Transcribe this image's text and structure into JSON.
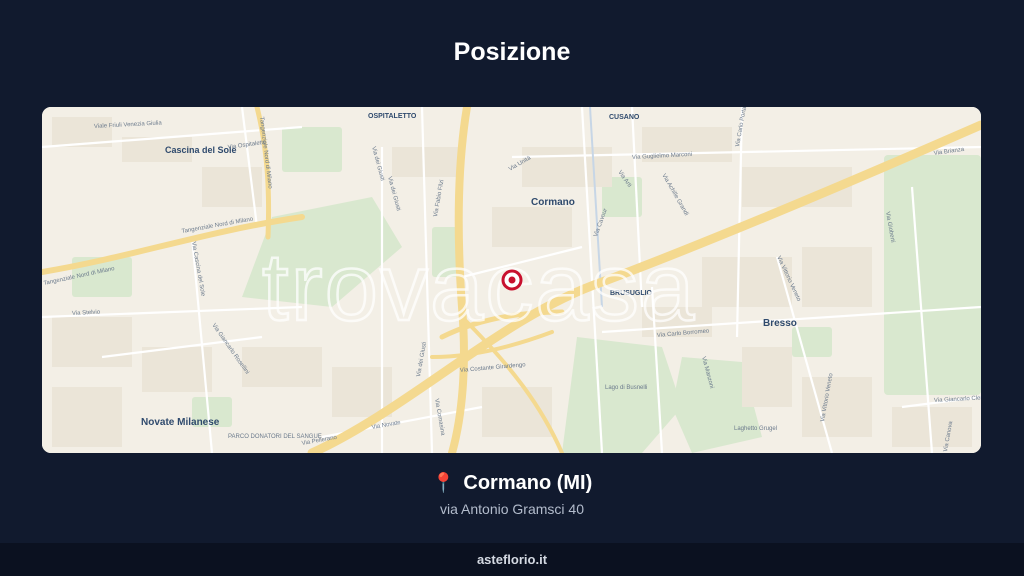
{
  "page": {
    "title": "Posizione"
  },
  "map": {
    "watermark": "trovacasa",
    "areas": {
      "cascina_del_sole": "Cascina del Sole",
      "ospitaletto": "OSPITALETTO",
      "cusano": "CUSANO",
      "cormano": "Cormano",
      "brusuglio": "BRUSUGLIO",
      "bresso": "Bresso",
      "novate_milanese": "Novate Milanese",
      "parco_donatori": "PARCO DONATORI DEL SANGUE",
      "lago_busnelli": "Lago di Busnelli",
      "laghetto": "Laghetto Grugel"
    },
    "streets": {
      "friuli": "Viale Friuli Venezia Giulia",
      "ospitaletto_via": "Via Ospitaletto",
      "tangenziale_1": "Tangenziale Nord di Milano",
      "tangenziale_2": "Tangenziale Nord di Milano",
      "tangenziale_3": "Tangenziale Nord di Milano",
      "giusti_1": "Via dei Giusti",
      "giusti_2": "Via dei Giusti",
      "giusti_3": "Via dei Giusti",
      "fabio_filzi": "Via Fabio Filzi",
      "marconi": "Via Guglielmo Marconi",
      "carlo_porta": "Via Carlo Porta",
      "brianza": "Via Brianza",
      "cascina_sole": "Via Cascina del Sole",
      "stelvio": "Via Stelvio",
      "rosellini": "Via Giancarlo Rosellini",
      "gioberti": "Via Gioberti",
      "canova": "Via Cavour",
      "vittorio_veneto_1": "Via Vittorio Veneto",
      "vittorio_veneto_2": "Via Vittorio Veneto",
      "clerici": "Via Giancarlo Clerici",
      "borromeo": "Via Carlo Borromeo",
      "costante": "Via Costante Girardengo",
      "novate": "Via Novate",
      "comasina": "Via Comasina",
      "pellerano": "Via Pellerano",
      "arti": "Via Arti",
      "achille_grandi": "Via Achille Grandi",
      "manzoni": "Via Manzoni",
      "canova_2": "Via Canova",
      "unita": "Via Unità"
    },
    "marker": {
      "color": "#c8102e"
    }
  },
  "location": {
    "icon": "map-pin-icon",
    "title": "Cormano (MI)",
    "address": "via Antonio Gramsci 40"
  },
  "footer": {
    "site": "asteflorio.it"
  }
}
